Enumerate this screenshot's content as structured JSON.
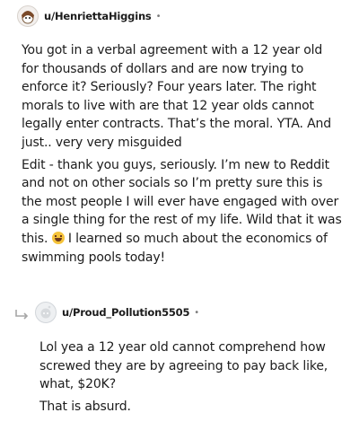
{
  "comment1": {
    "username": "u/HenriettaHiggins",
    "separator": "•",
    "paragraphs": [
      "You got in a verbal agreement with a 12 year old for thousands of dollars and are now trying to enforce it? Seriously? Four years later. The right morals to live with are that 12 year olds cannot legally enter contracts. That’s the moral. YTA. And just.. very very misguided",
      "Edit - thank you guys, seriously. I’m new to Reddit and not on other socials so I’m pretty sure this is the most people I will ever have engaged with over a single thing for the rest of my life. Wild that it was this."
    ],
    "paragraph2_after_emoji": " I learned so much about the economics of swimming pools today!",
    "emoji_icon": "grinning-sweat-emoji"
  },
  "comment2": {
    "username": "u/Proud_Pollution5505",
    "separator": "•",
    "paragraphs": [
      "Lol yea a 12 year old cannot comprehend how screwed they are by agreeing to pay back like, what, $20K?",
      "That is absurd."
    ]
  },
  "icons": {
    "avatar1": "snoo-avatar-icon",
    "avatar2": "default-avatar-icon",
    "reply": "reply-arrow-icon"
  }
}
